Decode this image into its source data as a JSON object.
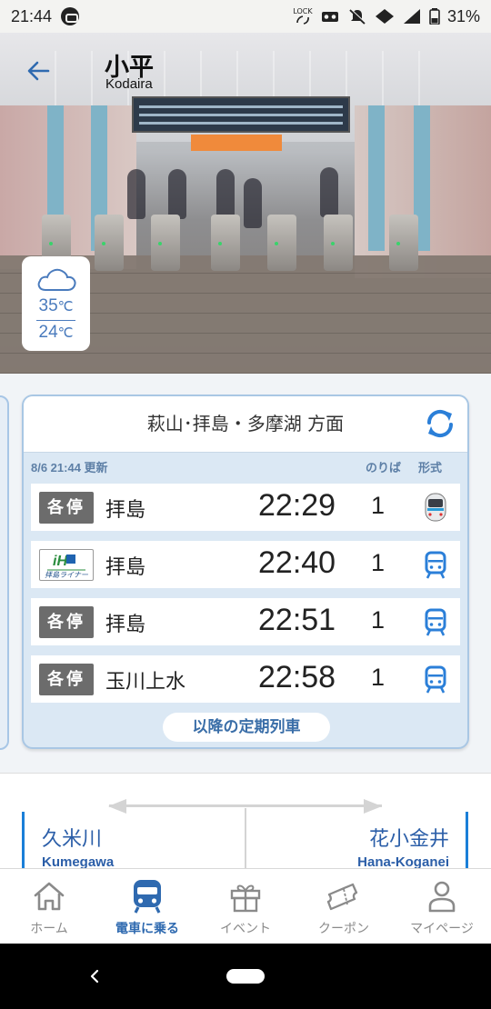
{
  "status_bar": {
    "time": "21:44",
    "lock_label": "LOCK",
    "battery_percent": "31%"
  },
  "header": {
    "station_name": "小平",
    "station_name_roman": "Kodaira"
  },
  "weather": {
    "icon": "cloud-icon",
    "high": "35",
    "low": "24",
    "unit": "℃"
  },
  "timetable": {
    "direction": "萩山･拝島・多摩湖 方面",
    "updated": "8/6 21:44 更新",
    "col_platform": "のりば",
    "col_type": "形式",
    "trains": [
      {
        "kind": "各停",
        "kind_style": "local",
        "dest": "拝島",
        "time": "22:29",
        "platform": "1",
        "type_icon": "train-photo-icon"
      },
      {
        "kind": "拝島ライナー",
        "kind_style": "liner",
        "dest": "拝島",
        "time": "22:40",
        "platform": "1",
        "type_icon": "train-icon"
      },
      {
        "kind": "各停",
        "kind_style": "local",
        "dest": "拝島",
        "time": "22:51",
        "platform": "1",
        "type_icon": "train-icon"
      },
      {
        "kind": "各停",
        "kind_style": "local",
        "dest": "玉川上水",
        "time": "22:58",
        "platform": "1",
        "type_icon": "train-icon"
      }
    ],
    "more_label": "以降の定期列車"
  },
  "neighbors": {
    "prev": {
      "name": "久米川",
      "roman": "Kumegawa"
    },
    "next": {
      "name": "花小金井",
      "roman": "Hana-Koganei"
    }
  },
  "tabs": [
    {
      "label": "ホーム",
      "icon": "home-icon",
      "active": false
    },
    {
      "label": "電車に乗る",
      "icon": "train-icon",
      "active": true
    },
    {
      "label": "イベント",
      "icon": "gift-icon",
      "active": false
    },
    {
      "label": "クーポン",
      "icon": "ticket-icon",
      "active": false
    },
    {
      "label": "マイページ",
      "icon": "person-icon",
      "active": false
    }
  ],
  "colors": {
    "accent": "#2f6ab0",
    "card_bg": "#dbe8f4",
    "local_badge": "#6c6c6c",
    "neighbor_line": "#1a7fd8"
  }
}
